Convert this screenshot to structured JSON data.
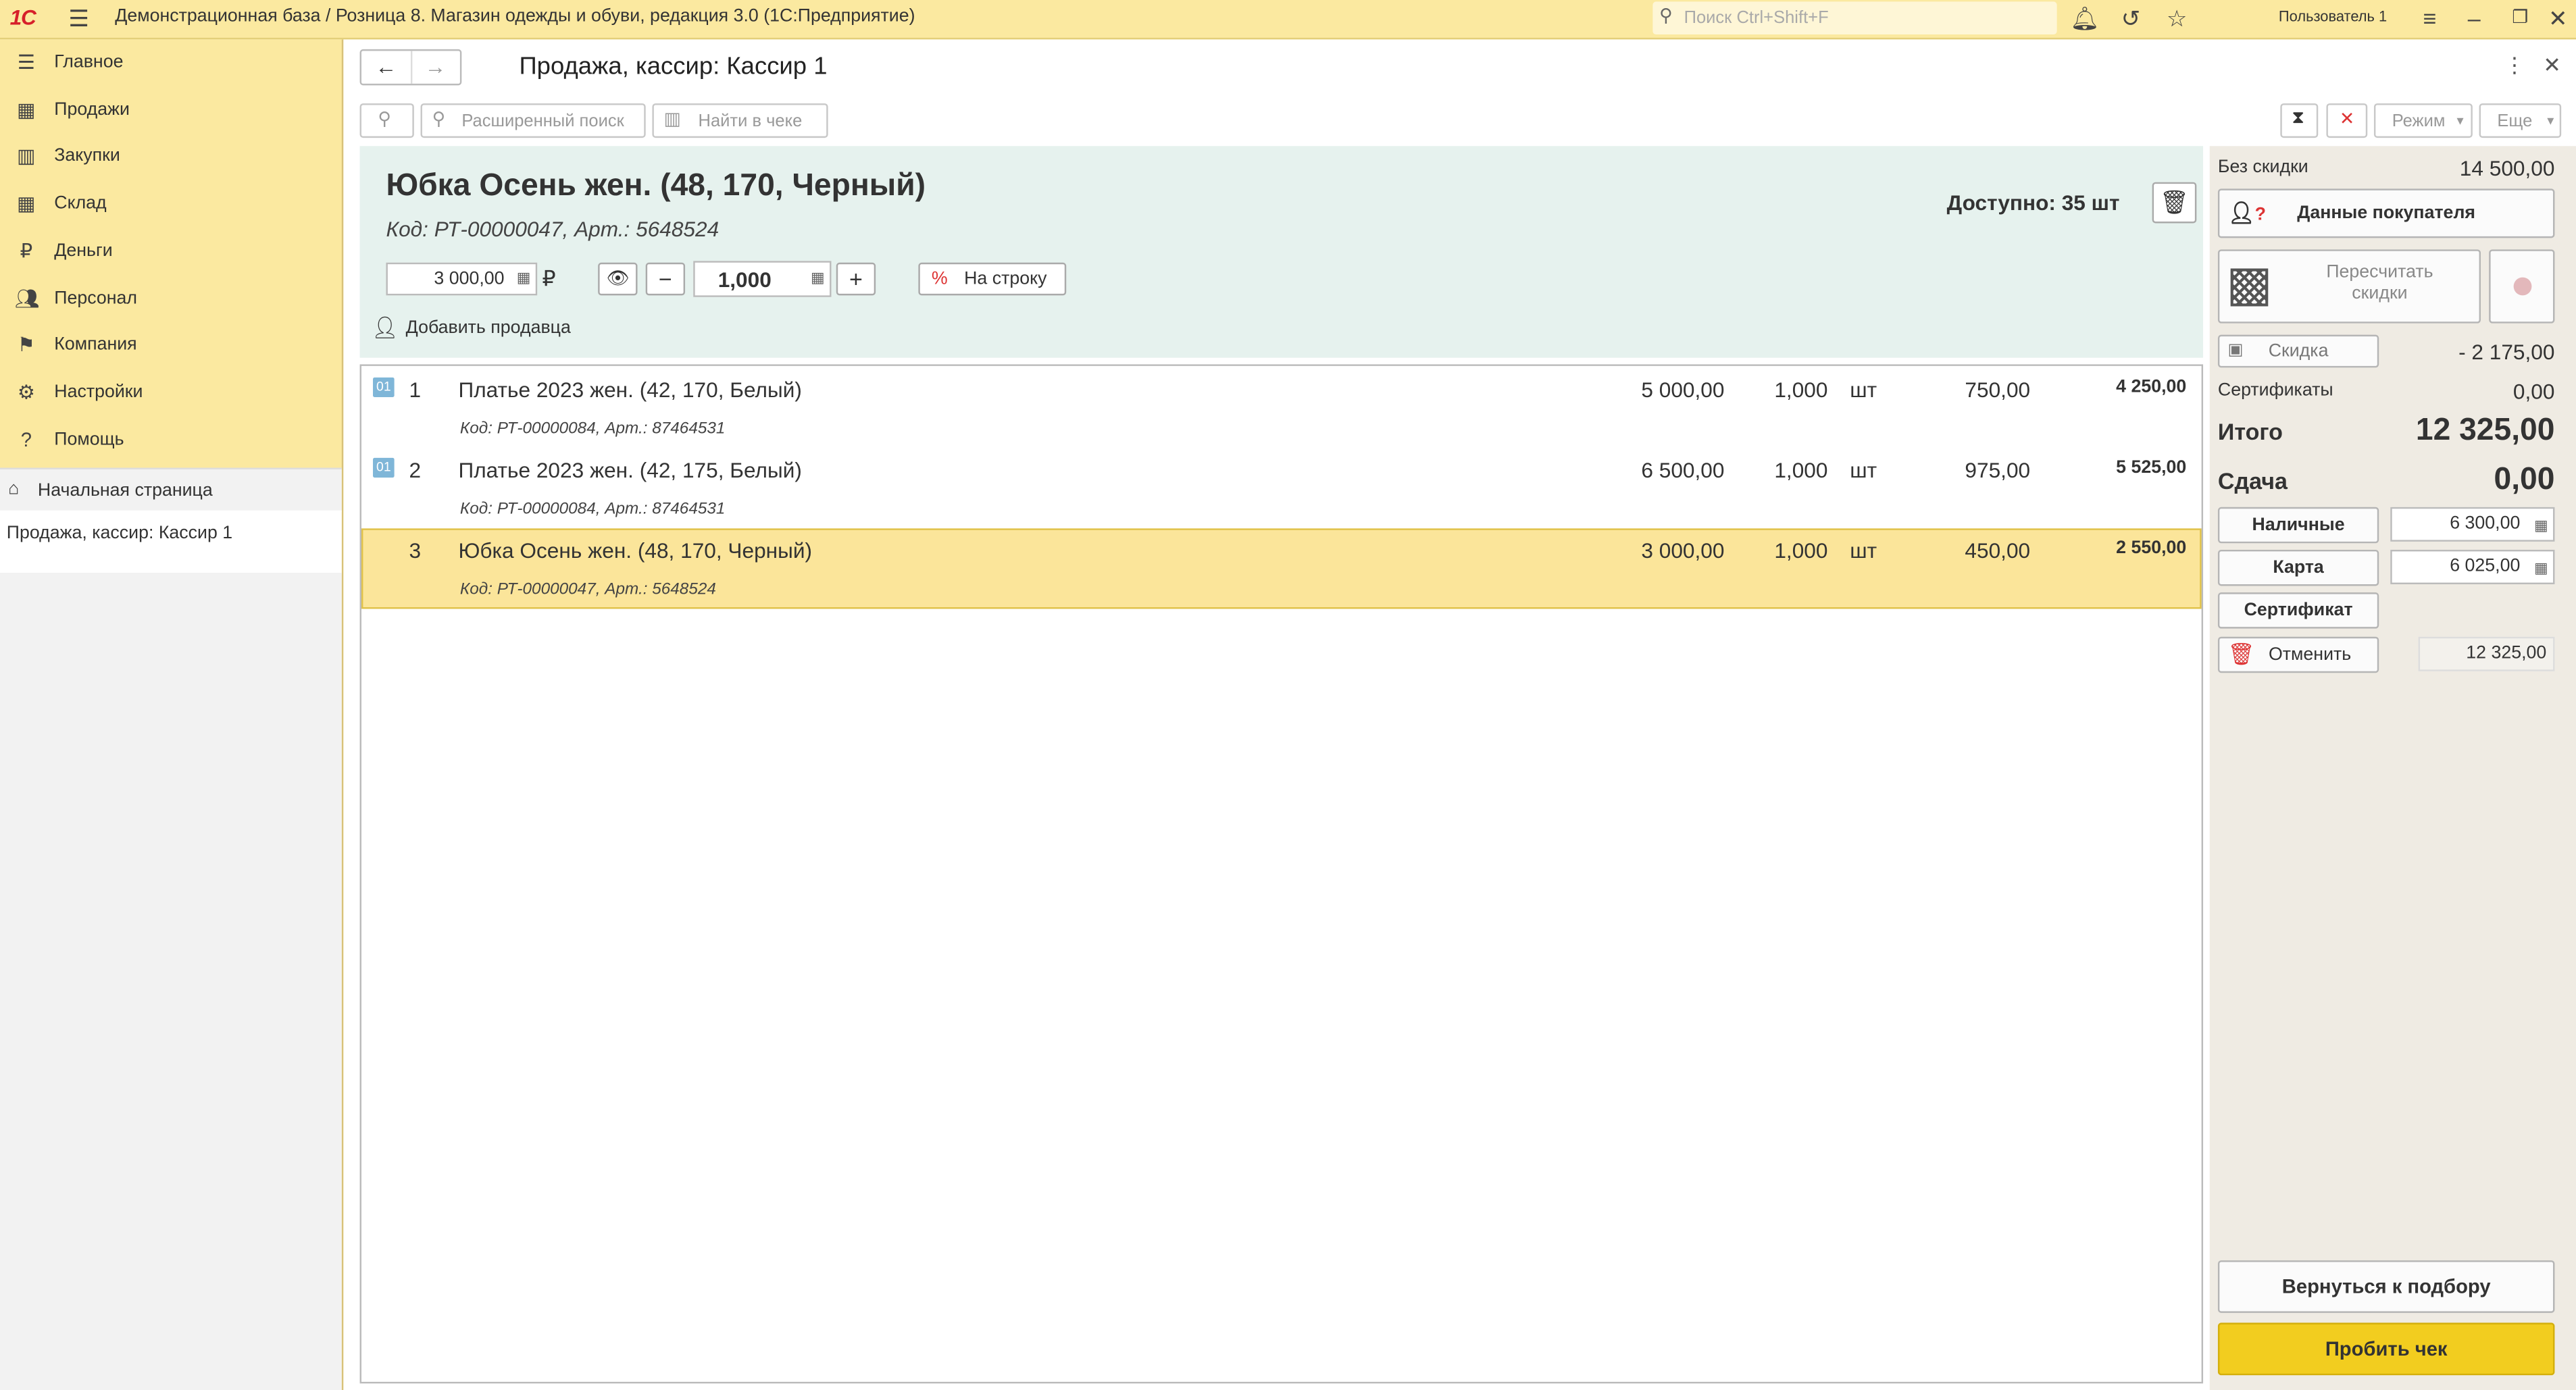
{
  "topbar": {
    "logo": "1С",
    "title": "Демонстрационная база / Розница 8. Магазин одежды и обуви, редакция 3.0  (1С:Предприятие)",
    "search_placeholder": "Поиск Ctrl+Shift+F",
    "user": "Пользователь 1"
  },
  "sidebar": {
    "items": [
      {
        "label": "Главное",
        "icon": "menu-icon"
      },
      {
        "label": "Продажи",
        "icon": "basket-icon"
      },
      {
        "label": "Закупки",
        "icon": "barcode-icon"
      },
      {
        "label": "Склад",
        "icon": "grid-icon"
      },
      {
        "label": "Деньги",
        "icon": "ruble-icon"
      },
      {
        "label": "Персонал",
        "icon": "people-icon"
      },
      {
        "label": "Компания",
        "icon": "flag-icon"
      },
      {
        "label": "Настройки",
        "icon": "gear-icon"
      },
      {
        "label": "Помощь",
        "icon": "help-icon"
      }
    ],
    "home_tab": "Начальная страница",
    "open_tab": "Продажа, кассир: Кассир 1"
  },
  "form": {
    "title": "Продажа, кассир: Кассир 1",
    "advanced_search": "Расширенный поиск",
    "find_in_receipt": "Найти в чеке",
    "mode": "Режим",
    "more": "Еще"
  },
  "current_item": {
    "name": "Юбка Осень жен. (48, 170, Черный)",
    "code": "Код: РТ-00000047, Арт.: 5648524",
    "available": "Доступно: 35 шт",
    "price": "3 000,00",
    "currency": "₽",
    "quantity": "1,000",
    "to_row": "На строку",
    "add_seller": "Добавить продавца"
  },
  "rows": [
    {
      "num": "1",
      "badge": "01",
      "name": "Платье  2023 жен. (42, 170, Белый)",
      "code": "Код: РТ-00000084, Арт.: 87464531",
      "price": "5 000,00",
      "qty": "1,000",
      "unit": "шт",
      "discount": "750,00",
      "sum": "4 250,00"
    },
    {
      "num": "2",
      "badge": "01",
      "name": "Платье  2023 жен. (42, 175, Белый)",
      "code": "Код: РТ-00000084, Арт.: 87464531",
      "price": "6 500,00",
      "qty": "1,000",
      "unit": "шт",
      "discount": "975,00",
      "sum": "5 525,00"
    },
    {
      "num": "3",
      "badge": "",
      "name": "Юбка Осень жен. (48, 170, Черный)",
      "code": "Код: РТ-00000047, Арт.: 5648524",
      "price": "3 000,00",
      "qty": "1,000",
      "unit": "шт",
      "discount": "450,00",
      "sum": "2 550,00"
    }
  ],
  "panel": {
    "no_discount_label": "Без скидки",
    "no_discount_value": "14 500,00",
    "buyer_data": "Данные покупателя",
    "recalc": "Пересчитать скидки",
    "discount_label": "Скидка",
    "discount_value": "- 2 175,00",
    "certificates_label": "Сертификаты",
    "certificates_value": "0,00",
    "total_label": "Итого",
    "total_value": "12 325,00",
    "change_label": "Сдача",
    "change_value": "0,00",
    "cash_label": "Наличные",
    "cash_value": "6 300,00",
    "card_label": "Карта",
    "card_value": "6 025,00",
    "certificate_btn": "Сертификат",
    "cancel_btn": "Отменить",
    "cancel_value": "12 325,00",
    "back_btn": "Вернуться к подбору",
    "print_btn": "Пробить чек"
  }
}
